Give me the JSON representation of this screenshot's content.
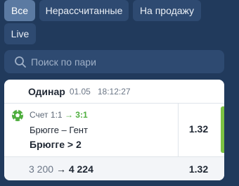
{
  "filters": {
    "all": "Все",
    "unsettled": "Нерассчитанные",
    "for_sale": "На продажу",
    "live": "Live"
  },
  "search": {
    "placeholder": "Поиск по пари",
    "value": ""
  },
  "bet": {
    "type": "Одинар",
    "date": "01.05",
    "time": "18:12:27",
    "score_label": "Счет",
    "score_before": "1:1",
    "score_arrow": "→",
    "score_after": "3:1",
    "match": "Брюгге – Гент",
    "outcome": "Брюгге > 2",
    "odd": "1.32",
    "stake": "3 200",
    "stake_arrow": "→",
    "potential_win": "4 224",
    "total_odd": "1.32",
    "sport_icon": "soccer-ball-icon"
  },
  "colors": {
    "background": "#213a5c",
    "chip": "#2e4a71",
    "chip_active": "#5b7aa2",
    "accent_green": "#4fae3f",
    "status_bar": "#7cc243"
  }
}
